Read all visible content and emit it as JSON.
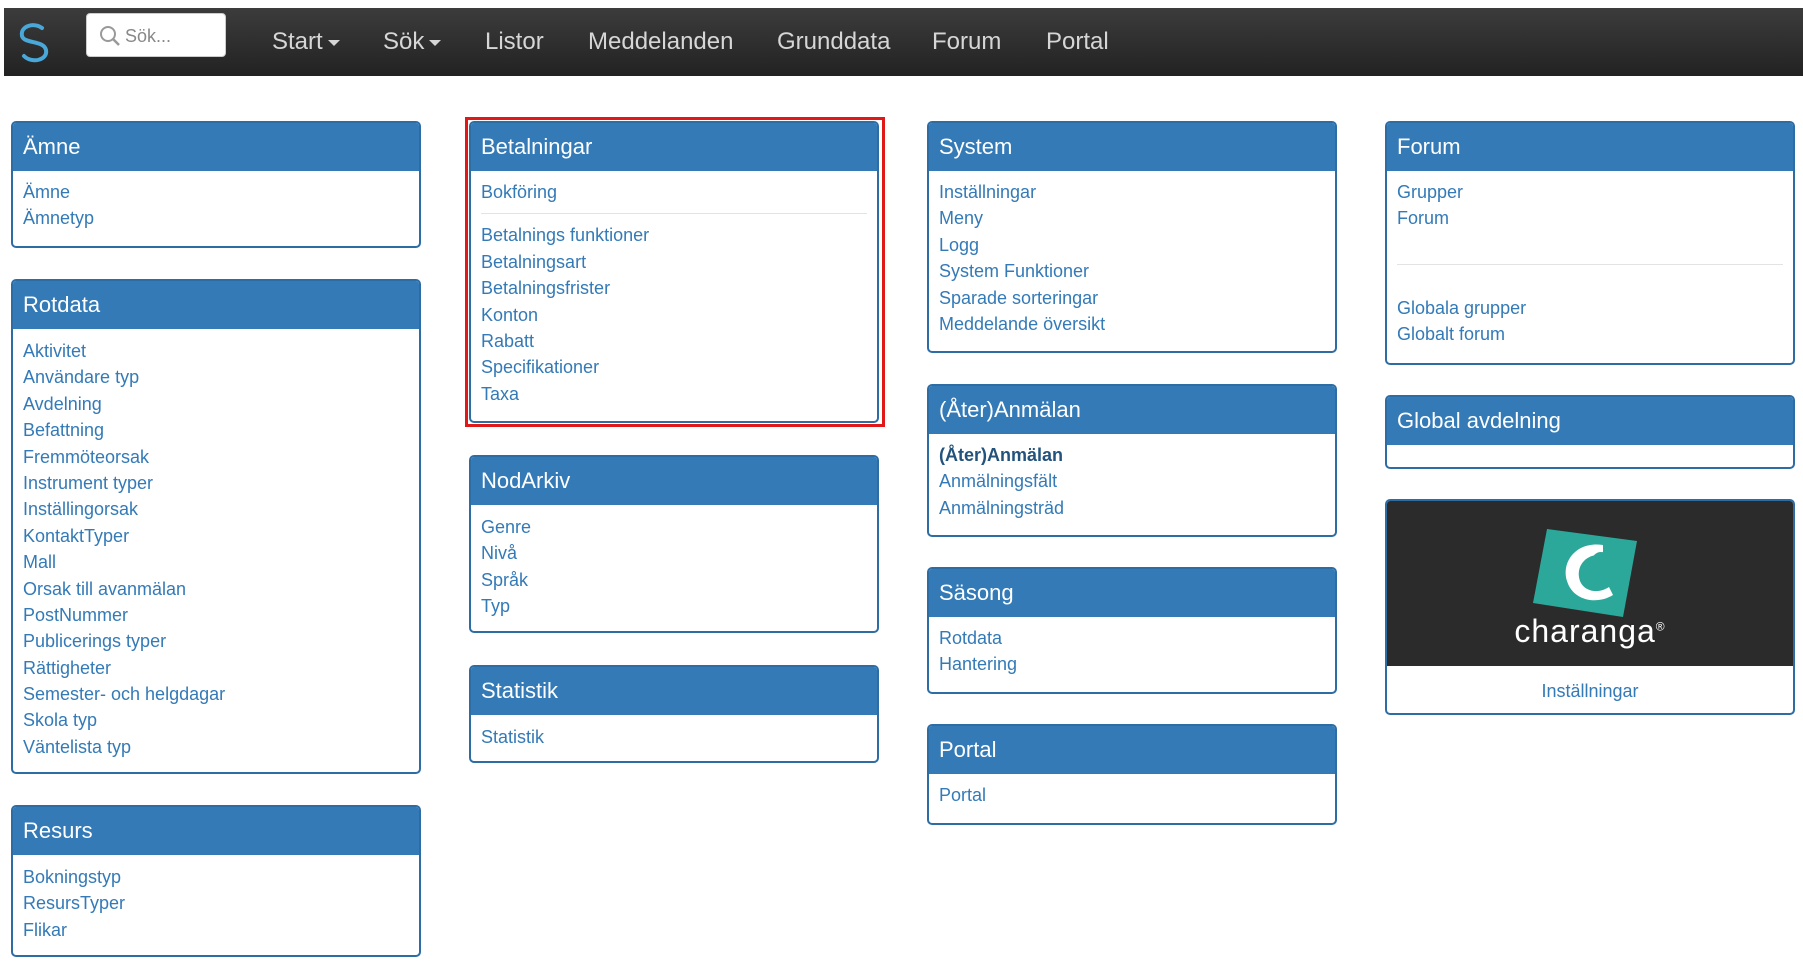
{
  "colors": {
    "navbar": "#2d2d2d",
    "panel_heading": "#337ab7",
    "link": "#337ab7",
    "highlight": "#e01818"
  },
  "navbar": {
    "search_placeholder": "Sök...",
    "items": [
      {
        "label": "Start",
        "dropdown": true
      },
      {
        "label": "Sök",
        "dropdown": true
      },
      {
        "label": "Listor",
        "dropdown": false
      },
      {
        "label": "Meddelanden",
        "dropdown": false
      },
      {
        "label": "Grunddata",
        "dropdown": false
      },
      {
        "label": "Forum",
        "dropdown": false
      },
      {
        "label": "Portal",
        "dropdown": false
      }
    ]
  },
  "panels": {
    "amne": {
      "title": "Ämne",
      "links": [
        "Ämne",
        "Ämnetyp"
      ]
    },
    "rotdata": {
      "title": "Rotdata",
      "links": [
        "Aktivitet",
        "Användare typ",
        "Avdelning",
        "Befattning",
        "Fremmöteorsak",
        "Instrument typer",
        "Inställingorsak",
        "KontaktTyper",
        "Mall",
        "Orsak till avanmälan",
        "PostNummer",
        "Publicerings typer",
        "Rättigheter",
        "Semester- och helgdagar",
        "Skola typ",
        "Väntelista typ"
      ]
    },
    "resurs": {
      "title": "Resurs",
      "links": [
        "Bokningstyp",
        "ResursTyper",
        "Flikar"
      ]
    },
    "betalningar": {
      "title": "Betalningar",
      "links": [
        "Bokföring",
        "Betalnings funktioner",
        "Betalningsart",
        "Betalningsfrister",
        "Konton",
        "Rabatt",
        "Specifikationer",
        "Taxa"
      ]
    },
    "nodarkiv": {
      "title": "NodArkiv",
      "links": [
        "Genre",
        "Nivå",
        "Språk",
        "Typ"
      ]
    },
    "statistik": {
      "title": "Statistik",
      "links": [
        "Statistik"
      ]
    },
    "system": {
      "title": "System",
      "links": [
        "Inställningar",
        "Meny",
        "Logg",
        "System Funktioner",
        "Sparade sorteringar",
        "Meddelande översikt"
      ]
    },
    "ateranmalan": {
      "title": "(Åter)Anmälan",
      "links": [
        "(Åter)Anmälan",
        "Anmälningsfält",
        "Anmälningsträd"
      ]
    },
    "sasong": {
      "title": "Säsong",
      "links": [
        "Rotdata",
        "Hantering"
      ]
    },
    "portal": {
      "title": "Portal",
      "links": [
        "Portal"
      ]
    },
    "forum": {
      "title": "Forum",
      "links": [
        "Grupper",
        "Forum",
        "Globala grupper",
        "Globalt forum"
      ]
    },
    "global_avdelning": {
      "title": "Global avdelning",
      "links": []
    },
    "charanga": {
      "brand": "charanga",
      "trademark": "®",
      "link": "Inställningar"
    }
  }
}
